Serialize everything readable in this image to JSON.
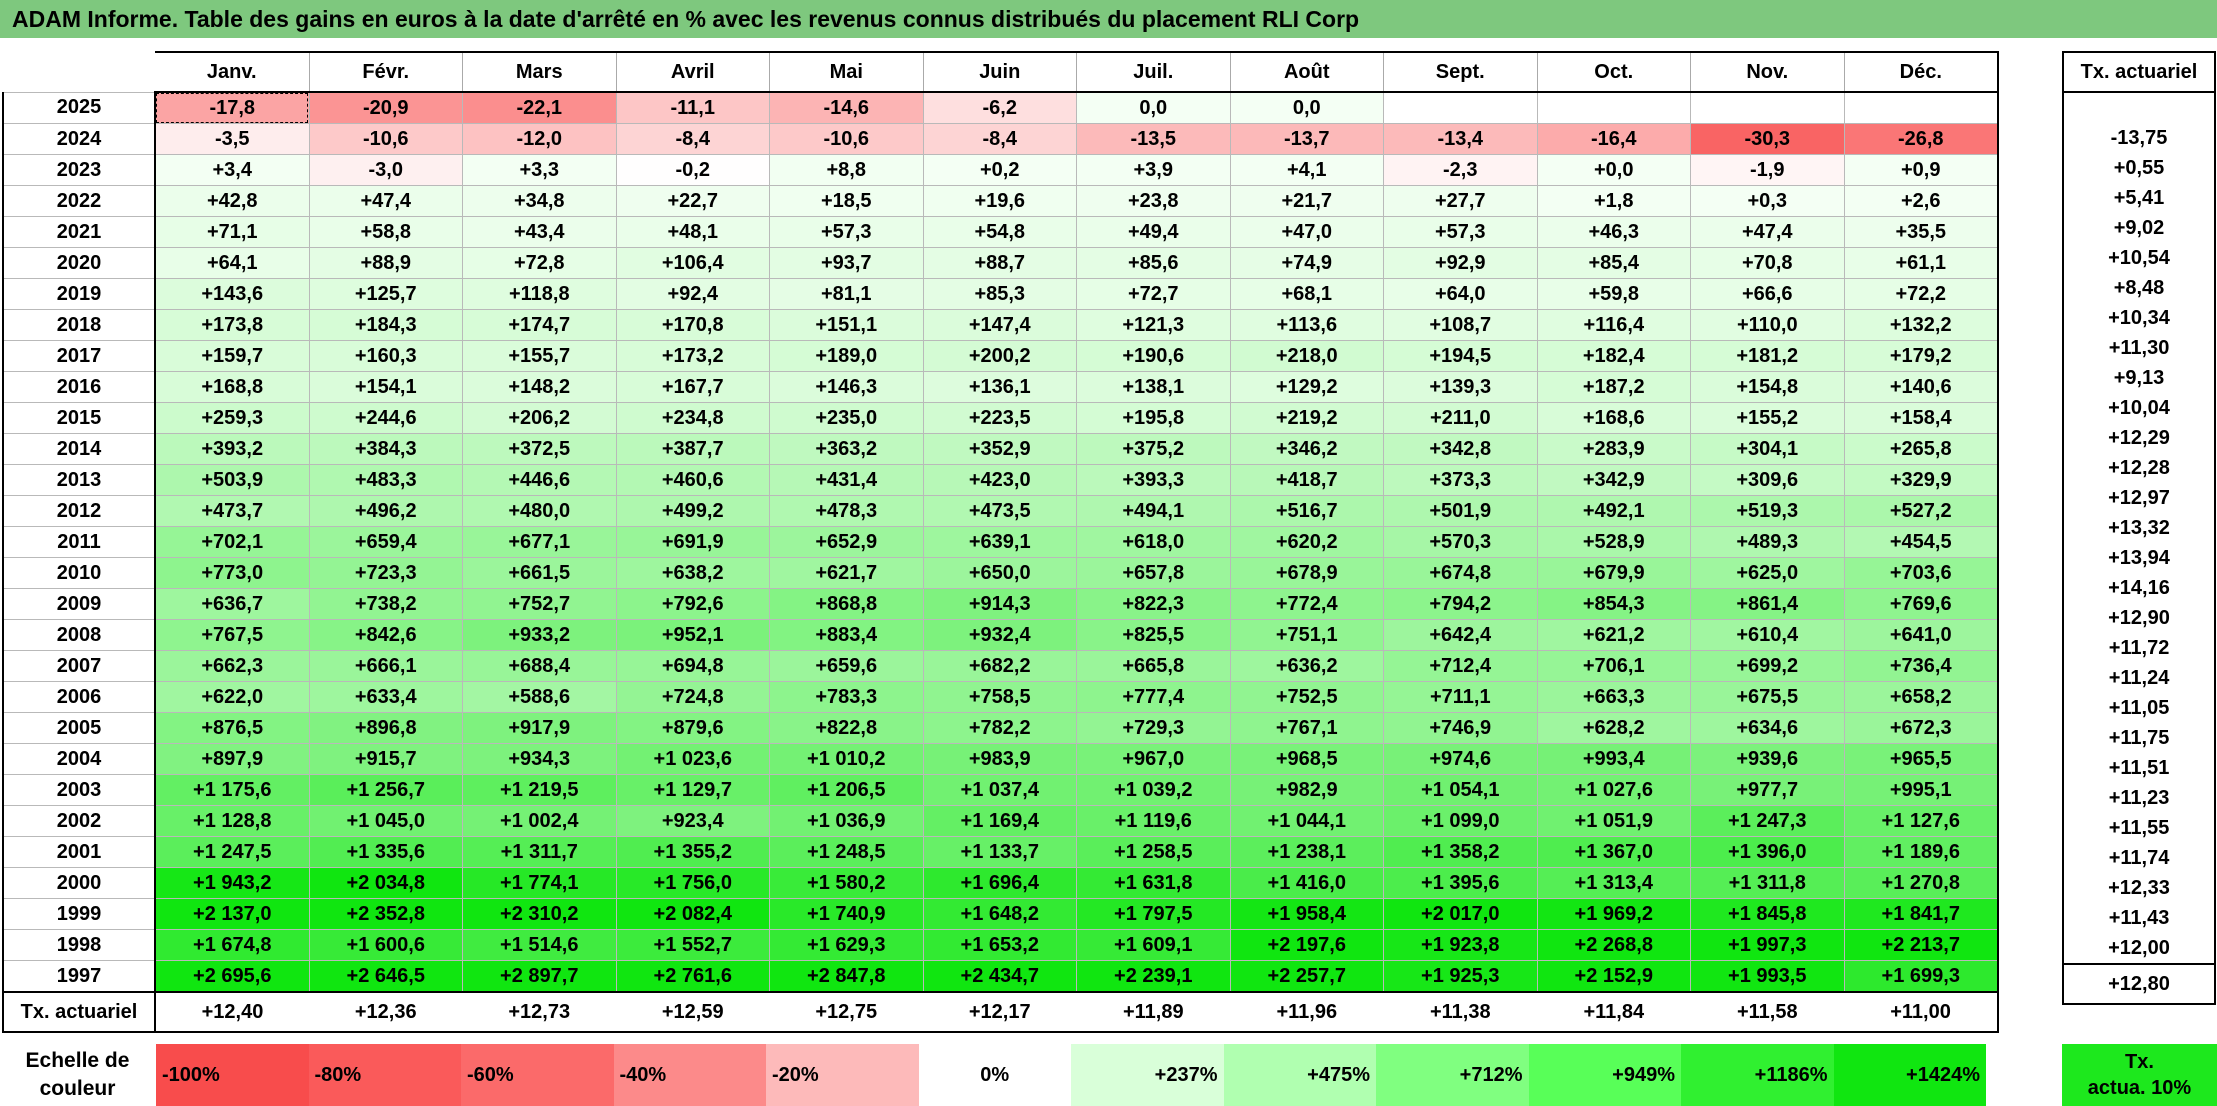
{
  "title": "ADAM Informe. Table des gains en euros à la date d'arrêté en % avec les revenus connus distribués du placement RLI Corp",
  "months": [
    "Janv.",
    "Févr.",
    "Mars",
    "Avril",
    "Mai",
    "Juin",
    "Juil.",
    "Août",
    "Sept.",
    "Oct.",
    "Nov.",
    "Déc."
  ],
  "tx_header": "Tx. actuariel",
  "rows": [
    {
      "year": "2025",
      "values": [
        "-17,8",
        "-20,9",
        "-22,1",
        "-11,1",
        "-14,6",
        "-6,2",
        "0,0",
        "0,0",
        "",
        "",
        "",
        ""
      ],
      "tx": ""
    },
    {
      "year": "2024",
      "values": [
        "-3,5",
        "-10,6",
        "-12,0",
        "-8,4",
        "-10,6",
        "-8,4",
        "-13,5",
        "-13,7",
        "-13,4",
        "-16,4",
        "-30,3",
        "-26,8"
      ],
      "tx": "-13,75"
    },
    {
      "year": "2023",
      "values": [
        "+3,4",
        "-3,0",
        "+3,3",
        "-0,2",
        "+8,8",
        "+0,2",
        "+3,9",
        "+4,1",
        "-2,3",
        "+0,0",
        "-1,9",
        "+0,9"
      ],
      "tx": "+0,55"
    },
    {
      "year": "2022",
      "values": [
        "+42,8",
        "+47,4",
        "+34,8",
        "+22,7",
        "+18,5",
        "+19,6",
        "+23,8",
        "+21,7",
        "+27,7",
        "+1,8",
        "+0,3",
        "+2,6"
      ],
      "tx": "+5,41"
    },
    {
      "year": "2021",
      "values": [
        "+71,1",
        "+58,8",
        "+43,4",
        "+48,1",
        "+57,3",
        "+54,8",
        "+49,4",
        "+47,0",
        "+57,3",
        "+46,3",
        "+47,4",
        "+35,5"
      ],
      "tx": "+9,02"
    },
    {
      "year": "2020",
      "values": [
        "+64,1",
        "+88,9",
        "+72,8",
        "+106,4",
        "+93,7",
        "+88,7",
        "+85,6",
        "+74,9",
        "+92,9",
        "+85,4",
        "+70,8",
        "+61,1"
      ],
      "tx": "+10,54"
    },
    {
      "year": "2019",
      "values": [
        "+143,6",
        "+125,7",
        "+118,8",
        "+92,4",
        "+81,1",
        "+85,3",
        "+72,7",
        "+68,1",
        "+64,0",
        "+59,8",
        "+66,6",
        "+72,2"
      ],
      "tx": "+8,48"
    },
    {
      "year": "2018",
      "values": [
        "+173,8",
        "+184,3",
        "+174,7",
        "+170,8",
        "+151,1",
        "+147,4",
        "+121,3",
        "+113,6",
        "+108,7",
        "+116,4",
        "+110,0",
        "+132,2"
      ],
      "tx": "+10,34"
    },
    {
      "year": "2017",
      "values": [
        "+159,7",
        "+160,3",
        "+155,7",
        "+173,2",
        "+189,0",
        "+200,2",
        "+190,6",
        "+218,0",
        "+194,5",
        "+182,4",
        "+181,2",
        "+179,2"
      ],
      "tx": "+11,30"
    },
    {
      "year": "2016",
      "values": [
        "+168,8",
        "+154,1",
        "+148,2",
        "+167,7",
        "+146,3",
        "+136,1",
        "+138,1",
        "+129,2",
        "+139,3",
        "+187,2",
        "+154,8",
        "+140,6"
      ],
      "tx": "+9,13"
    },
    {
      "year": "2015",
      "values": [
        "+259,3",
        "+244,6",
        "+206,2",
        "+234,8",
        "+235,0",
        "+223,5",
        "+195,8",
        "+219,2",
        "+211,0",
        "+168,6",
        "+155,2",
        "+158,4"
      ],
      "tx": "+10,04"
    },
    {
      "year": "2014",
      "values": [
        "+393,2",
        "+384,3",
        "+372,5",
        "+387,7",
        "+363,2",
        "+352,9",
        "+375,2",
        "+346,2",
        "+342,8",
        "+283,9",
        "+304,1",
        "+265,8"
      ],
      "tx": "+12,29"
    },
    {
      "year": "2013",
      "values": [
        "+503,9",
        "+483,3",
        "+446,6",
        "+460,6",
        "+431,4",
        "+423,0",
        "+393,3",
        "+418,7",
        "+373,3",
        "+342,9",
        "+309,6",
        "+329,9"
      ],
      "tx": "+12,28"
    },
    {
      "year": "2012",
      "values": [
        "+473,7",
        "+496,2",
        "+480,0",
        "+499,2",
        "+478,3",
        "+473,5",
        "+494,1",
        "+516,7",
        "+501,9",
        "+492,1",
        "+519,3",
        "+527,2"
      ],
      "tx": "+12,97"
    },
    {
      "year": "2011",
      "values": [
        "+702,1",
        "+659,4",
        "+677,1",
        "+691,9",
        "+652,9",
        "+639,1",
        "+618,0",
        "+620,2",
        "+570,3",
        "+528,9",
        "+489,3",
        "+454,5"
      ],
      "tx": "+13,32"
    },
    {
      "year": "2010",
      "values": [
        "+773,0",
        "+723,3",
        "+661,5",
        "+638,2",
        "+621,7",
        "+650,0",
        "+657,8",
        "+678,9",
        "+674,8",
        "+679,9",
        "+625,0",
        "+703,6"
      ],
      "tx": "+13,94"
    },
    {
      "year": "2009",
      "values": [
        "+636,7",
        "+738,2",
        "+752,7",
        "+792,6",
        "+868,8",
        "+914,3",
        "+822,3",
        "+772,4",
        "+794,2",
        "+854,3",
        "+861,4",
        "+769,6"
      ],
      "tx": "+14,16"
    },
    {
      "year": "2008",
      "values": [
        "+767,5",
        "+842,6",
        "+933,2",
        "+952,1",
        "+883,4",
        "+932,4",
        "+825,5",
        "+751,1",
        "+642,4",
        "+621,2",
        "+610,4",
        "+641,0"
      ],
      "tx": "+12,90"
    },
    {
      "year": "2007",
      "values": [
        "+662,3",
        "+666,1",
        "+688,4",
        "+694,8",
        "+659,6",
        "+682,2",
        "+665,8",
        "+636,2",
        "+712,4",
        "+706,1",
        "+699,2",
        "+736,4"
      ],
      "tx": "+11,72"
    },
    {
      "year": "2006",
      "values": [
        "+622,0",
        "+633,4",
        "+588,6",
        "+724,8",
        "+783,3",
        "+758,5",
        "+777,4",
        "+752,5",
        "+711,1",
        "+663,3",
        "+675,5",
        "+658,2"
      ],
      "tx": "+11,24"
    },
    {
      "year": "2005",
      "values": [
        "+876,5",
        "+896,8",
        "+917,9",
        "+879,6",
        "+822,8",
        "+782,2",
        "+729,3",
        "+767,1",
        "+746,9",
        "+628,2",
        "+634,6",
        "+672,3"
      ],
      "tx": "+11,05"
    },
    {
      "year": "2004",
      "values": [
        "+897,9",
        "+915,7",
        "+934,3",
        "+1 023,6",
        "+1 010,2",
        "+983,9",
        "+967,0",
        "+968,5",
        "+974,6",
        "+993,4",
        "+939,6",
        "+965,5"
      ],
      "tx": "+11,75"
    },
    {
      "year": "2003",
      "values": [
        "+1 175,6",
        "+1 256,7",
        "+1 219,5",
        "+1 129,7",
        "+1 206,5",
        "+1 037,4",
        "+1 039,2",
        "+982,9",
        "+1 054,1",
        "+1 027,6",
        "+977,7",
        "+995,1"
      ],
      "tx": "+11,51"
    },
    {
      "year": "2002",
      "values": [
        "+1 128,8",
        "+1 045,0",
        "+1 002,4",
        "+923,4",
        "+1 036,9",
        "+1 169,4",
        "+1 119,6",
        "+1 044,1",
        "+1 099,0",
        "+1 051,9",
        "+1 247,3",
        "+1 127,6"
      ],
      "tx": "+11,23"
    },
    {
      "year": "2001",
      "values": [
        "+1 247,5",
        "+1 335,6",
        "+1 311,7",
        "+1 355,2",
        "+1 248,5",
        "+1 133,7",
        "+1 258,5",
        "+1 238,1",
        "+1 358,2",
        "+1 367,0",
        "+1 396,0",
        "+1 189,6"
      ],
      "tx": "+11,55"
    },
    {
      "year": "2000",
      "values": [
        "+1 943,2",
        "+2 034,8",
        "+1 774,1",
        "+1 756,0",
        "+1 580,2",
        "+1 696,4",
        "+1 631,8",
        "+1 416,0",
        "+1 395,6",
        "+1 313,4",
        "+1 311,8",
        "+1 270,8"
      ],
      "tx": "+11,74"
    },
    {
      "year": "1999",
      "values": [
        "+2 137,0",
        "+2 352,8",
        "+2 310,2",
        "+2 082,4",
        "+1 740,9",
        "+1 648,2",
        "+1 797,5",
        "+1 958,4",
        "+2 017,0",
        "+1 969,2",
        "+1 845,8",
        "+1 841,7"
      ],
      "tx": "+12,33"
    },
    {
      "year": "1998",
      "values": [
        "+1 674,8",
        "+1 600,6",
        "+1 514,6",
        "+1 552,7",
        "+1 629,3",
        "+1 653,2",
        "+1 609,1",
        "+2 197,6",
        "+1 923,8",
        "+2 268,8",
        "+1 997,3",
        "+2 213,7"
      ],
      "tx": "+11,43"
    },
    {
      "year": "1997",
      "values": [
        "+2 695,6",
        "+2 646,5",
        "+2 897,7",
        "+2 761,6",
        "+2 847,8",
        "+2 434,7",
        "+2 239,1",
        "+2 257,7",
        "+1 925,3",
        "+2 152,9",
        "+1 993,5",
        "+1 699,3"
      ],
      "tx": "+12,00"
    }
  ],
  "footer": {
    "label": "Tx. actuariel",
    "values": [
      "+12,40",
      "+12,36",
      "+12,73",
      "+12,59",
      "+12,75",
      "+12,17",
      "+11,89",
      "+11,96",
      "+11,38",
      "+11,84",
      "+11,58",
      "+11,00"
    ],
    "tx": "+12,80"
  },
  "legend": {
    "label": [
      "Echelle de",
      "couleur"
    ],
    "items": [
      {
        "text": "-100%",
        "color": "#f84c4c",
        "align": "left"
      },
      {
        "text": "-80%",
        "color": "#fa5a5a",
        "align": "left"
      },
      {
        "text": "-60%",
        "color": "#fb6a6a",
        "align": "left"
      },
      {
        "text": "-40%",
        "color": "#fc8a8a",
        "align": "left"
      },
      {
        "text": "-20%",
        "color": "#fdbaba",
        "align": "left"
      },
      {
        "text": "0%",
        "color": "#ffffff",
        "align": "center"
      },
      {
        "text": "+237%",
        "color": "#d9ffd9",
        "align": "right"
      },
      {
        "text": "+475%",
        "color": "#b0ffb0",
        "align": "right"
      },
      {
        "text": "+712%",
        "color": "#80ff80",
        "align": "right"
      },
      {
        "text": "+949%",
        "color": "#58ff58",
        "align": "right"
      },
      {
        "text": "+1186%",
        "color": "#30f030",
        "align": "right"
      },
      {
        "text": "+1424%",
        "color": "#10e610",
        "align": "right"
      }
    ],
    "tx_box": [
      "Tx.",
      "actua. 10%"
    ],
    "tx_box_color": "#1de81d"
  }
}
